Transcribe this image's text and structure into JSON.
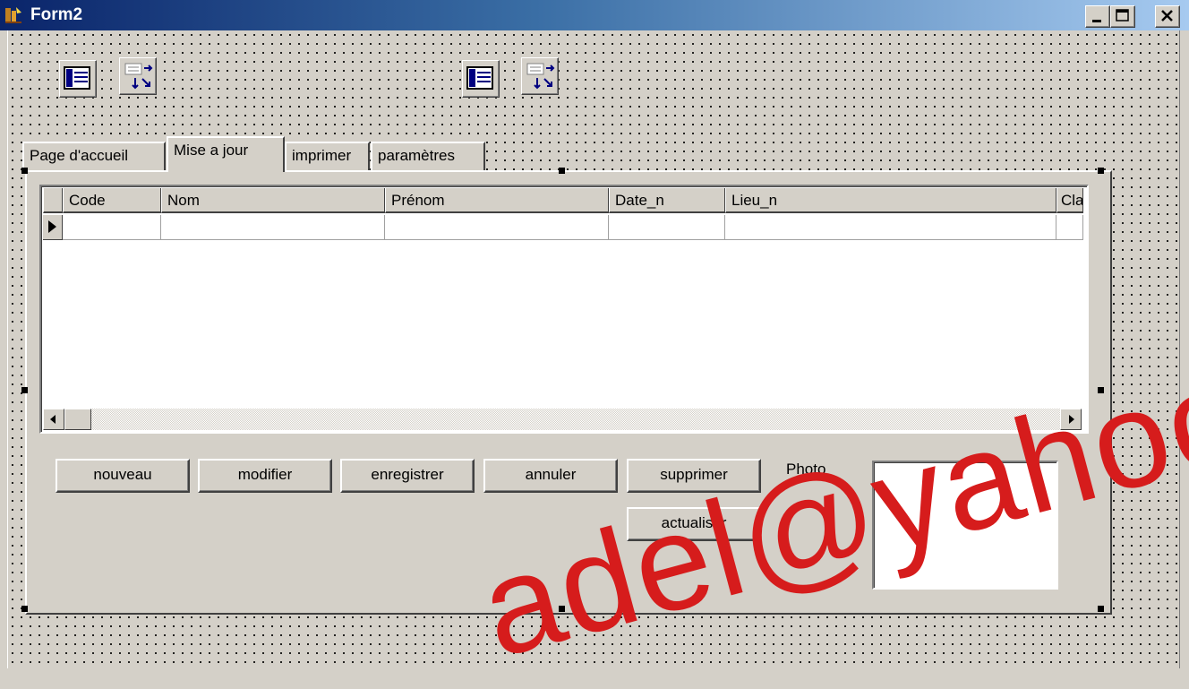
{
  "window": {
    "title": "Form2"
  },
  "tabs": [
    {
      "label": "Page d'accueil"
    },
    {
      "label": "Mise a jour"
    },
    {
      "label": "imprimer"
    },
    {
      "label": "paramètres"
    }
  ],
  "grid": {
    "columns": [
      "Code",
      "Nom",
      "Prénom",
      "Date_n",
      "Lieu_n",
      "Cla"
    ]
  },
  "buttons": {
    "nouveau": "nouveau",
    "modifier": "modifier",
    "enregistrer": "enregistrer",
    "annuler": "annuler",
    "supprimer": "supprimer",
    "actualiser": "actualiser"
  },
  "photo_label": "Photo",
  "watermark": "adel@yahoo.co",
  "icons": [
    "app-icon",
    "minimize-icon",
    "maximize-icon",
    "close-icon",
    "table-component-icon",
    "datasource-component-icon"
  ]
}
